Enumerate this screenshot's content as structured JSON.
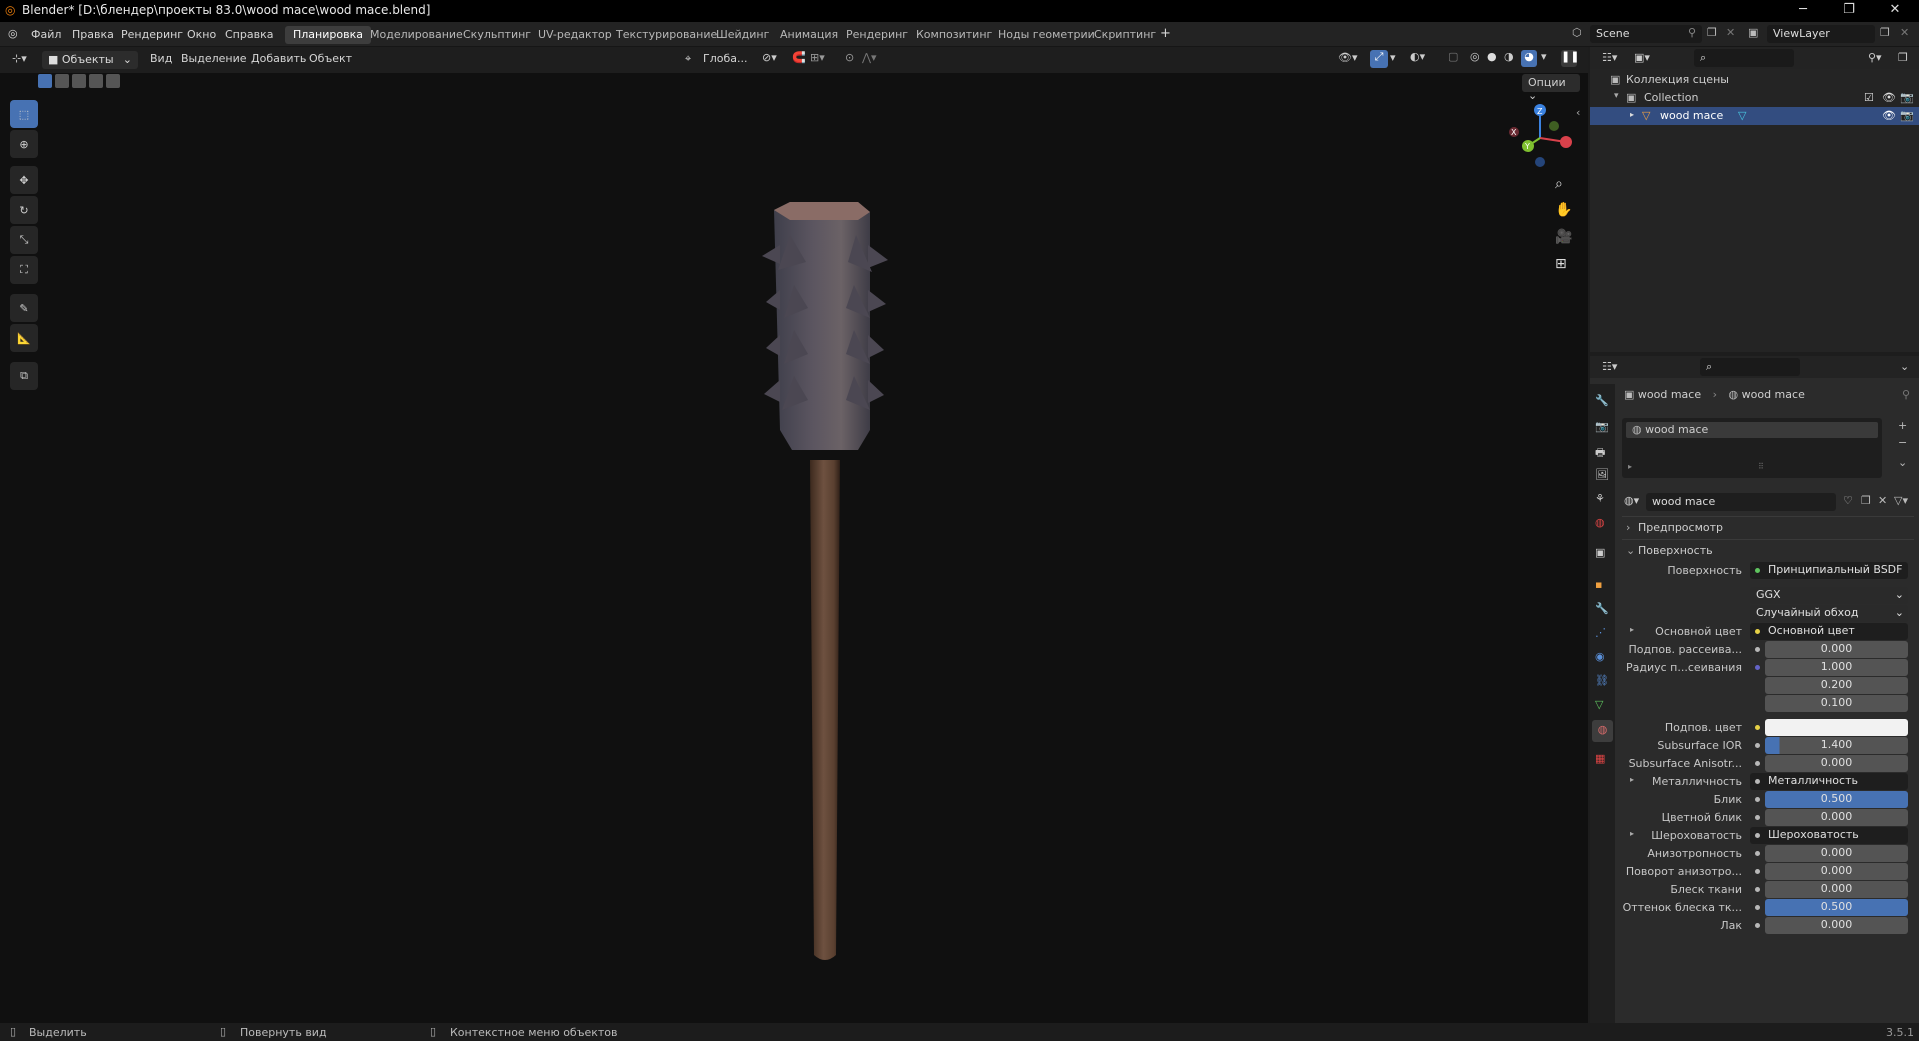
{
  "title": "Blender* [D:\\блендер\\проекты 83.0\\wood mace\\wood mace.blend]",
  "menu": [
    "Файл",
    "Правка",
    "Рендеринг",
    "Окно",
    "Справка"
  ],
  "workspaces": [
    "Планировка",
    "Моделирование",
    "Скульптинг",
    "UV-редактор",
    "Текстурирование",
    "Шейдинг",
    "Анимация",
    "Рендеринг",
    "Композитинг",
    "Ноды геометрии",
    "Скриптинг"
  ],
  "active_workspace": "Планировка",
  "add_tab": "+",
  "scene": "Scene",
  "view_layer": "ViewLayer",
  "viewport_header": {
    "mode": "Объекты",
    "menus": [
      "Вид",
      "Выделение",
      "Добавить",
      "Объект"
    ],
    "transform_orientation": "Глоба...",
    "options": "Опции"
  },
  "outliner": {
    "scene_collection": "Коллекция сцены",
    "collection": "Collection",
    "object": "wood mace"
  },
  "properties": {
    "breadcrumb_object": "wood mace",
    "breadcrumb_material": "wood mace",
    "slot": "wood mace",
    "material_name": "wood mace",
    "preview_panel": "Предпросмотр",
    "surface_panel": "Поверхность",
    "rows": [
      {
        "label": "Поверхность",
        "value": "Принципиальный BSDF",
        "kind": "link"
      },
      {
        "label": "",
        "value": "GGX",
        "kind": "dropdown"
      },
      {
        "label": "",
        "value": "Случайный обход",
        "kind": "dropdown"
      },
      {
        "label": "Основной цвет",
        "value": "Основной цвет",
        "kind": "link"
      },
      {
        "label": "Подпов. рассеива...",
        "value": "0.000",
        "kind": "num"
      },
      {
        "label": "Радиус п...сеивания",
        "value": "1.000",
        "kind": "num"
      },
      {
        "label": "",
        "value": "0.200",
        "kind": "num"
      },
      {
        "label": "",
        "value": "0.100",
        "kind": "num"
      },
      {
        "label": "Подпов. цвет",
        "value": "",
        "kind": "color"
      },
      {
        "label": "Subsurface IOR",
        "value": "1.400",
        "kind": "num"
      },
      {
        "label": "Subsurface Anisotr...",
        "value": "0.000",
        "kind": "num"
      },
      {
        "label": "Металличность",
        "value": "Металличность",
        "kind": "link"
      },
      {
        "label": "Блик",
        "value": "0.500",
        "kind": "num"
      },
      {
        "label": "Цветной блик",
        "value": "0.000",
        "kind": "num"
      },
      {
        "label": "Шероховатость",
        "value": "Шероховатость",
        "kind": "link"
      },
      {
        "label": "Анизотропность",
        "value": "0.000",
        "kind": "num"
      },
      {
        "label": "Поворот анизотро...",
        "value": "0.000",
        "kind": "num"
      },
      {
        "label": "Блеск ткани",
        "value": "0.000",
        "kind": "num"
      },
      {
        "label": "Оттенок блеска тк...",
        "value": "0.500",
        "kind": "num"
      },
      {
        "label": "Лак",
        "value": "0.000",
        "kind": "num"
      }
    ]
  },
  "status": {
    "select": "Выделить",
    "rotate": "Повернуть вид",
    "context": "Контекстное меню объектов",
    "version": "3.5.1"
  },
  "gizmo": {
    "x": "X",
    "y": "Y",
    "z": "Z"
  }
}
